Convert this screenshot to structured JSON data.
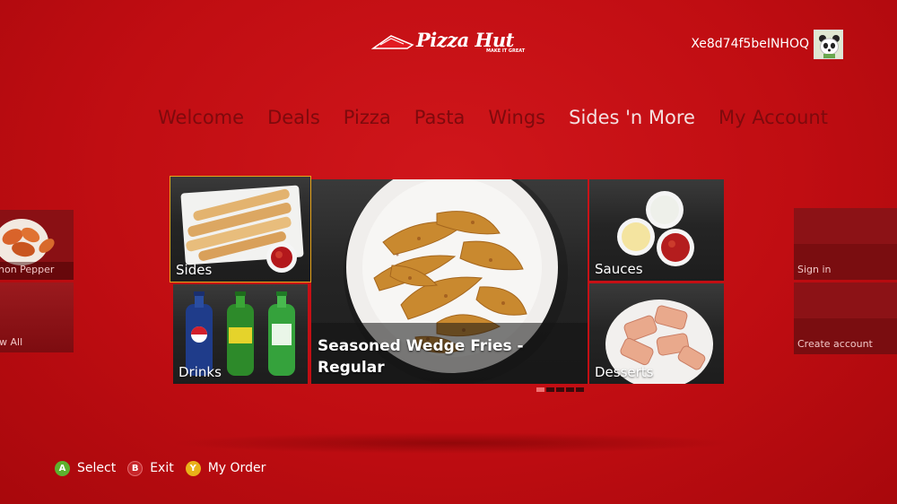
{
  "header": {
    "logo_text": "Pizza Hut",
    "logo_tagline": "MAKE IT GREAT",
    "gamertag": "Xe8d74f5beINHOQ"
  },
  "nav": {
    "items": [
      {
        "label": "Welcome"
      },
      {
        "label": "Deals"
      },
      {
        "label": "Pizza"
      },
      {
        "label": "Pasta"
      },
      {
        "label": "Wings"
      },
      {
        "label": "Sides 'n More"
      },
      {
        "label": "My Account"
      }
    ],
    "active": "Sides 'n More"
  },
  "tiles": {
    "sides": "Sides",
    "drinks": "Drinks",
    "featured": "Seasoned Wedge Fries - Regular",
    "sauces": "Sauces",
    "desserts": "Desserts"
  },
  "left_peek": {
    "top_label": "non Pepper",
    "bottom_label": "w All"
  },
  "right_peek": {
    "top_label": "Sign in",
    "bottom_label": "Create account"
  },
  "pager": {
    "total": 5,
    "current": 1
  },
  "legend": [
    {
      "key": "A",
      "label": "Select",
      "color": "#5db12e"
    },
    {
      "key": "B",
      "label": "Exit",
      "color": "#c7262a"
    },
    {
      "key": "Y",
      "label": "My Order",
      "color": "#e9b219"
    }
  ],
  "colors": {
    "background": "#c00d12",
    "focus_outline": "#e8a51a",
    "nav_inactive": "#7e0a0d",
    "nav_active": "#f4e0e0"
  }
}
